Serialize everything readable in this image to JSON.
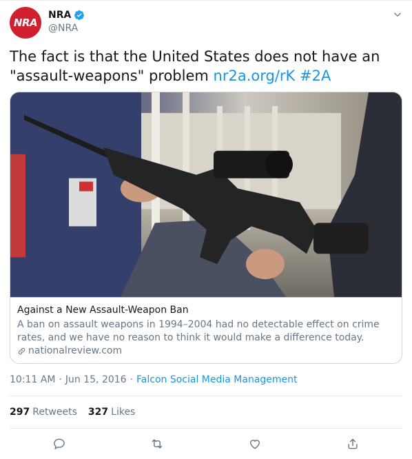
{
  "account": {
    "name": "NRA",
    "handle": "@NRA",
    "avatar_text": "NRA",
    "verified": true,
    "brand_color": "#d0202e"
  },
  "tweet": {
    "text": "The fact is that the United States does not have an \"assault-weapons\" problem",
    "link": "nr2a.org/rK",
    "hashtag": "#2A"
  },
  "card": {
    "title": "Against a New Assault-Weapon Ban",
    "description": "A ban on assault weapons in 1994–2004 had no detectable effect on crime rates, and we have no reason to think it would make a difference today.",
    "domain": "nationalreview.com"
  },
  "meta": {
    "time": "10:11 AM",
    "separator": "·",
    "date": "Jun 15, 2016",
    "source": "Falcon Social Media Management"
  },
  "stats": {
    "retweets_count": "297",
    "retweets_label": "Retweets",
    "likes_count": "327",
    "likes_label": "Likes"
  },
  "icons": {
    "reply": "reply-icon",
    "retweet": "retweet-icon",
    "like": "heart-icon",
    "share": "share-icon",
    "more": "chevron-down-icon",
    "verified": "verified-badge-icon",
    "link": "link-icon"
  },
  "colors": {
    "link_blue": "#1b95e0",
    "secondary_text": "#657786",
    "border": "#ccd6dd"
  }
}
